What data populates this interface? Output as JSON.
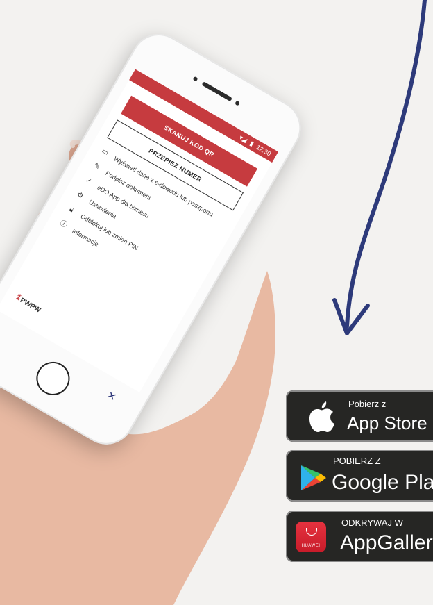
{
  "phone": {
    "status_time": "12:30",
    "scan_button": "SKANUJ KOD QR",
    "type_button": "PRZEPISZ NUMER",
    "menu": [
      {
        "icon": "id-card-icon",
        "label": "Wyświetl dane z e-dowodu lub paszportu"
      },
      {
        "icon": "signature-icon",
        "label": "Podpisz dokument"
      },
      {
        "icon": "check-icon",
        "label": "eDO App dla biznesu"
      },
      {
        "icon": "gear-icon",
        "label": "Ustawienia"
      },
      {
        "icon": "lock-icon",
        "label": "Odblokuj lub zmień PIN"
      },
      {
        "icon": "info-icon",
        "label": "Informacje"
      }
    ],
    "logo": "PWPW",
    "close_symbol": "×"
  },
  "badges": {
    "appstore": {
      "small": "Pobierz z",
      "big": "App Store"
    },
    "googleplay": {
      "small": "POBIERZ Z",
      "big": "Google Play"
    },
    "appgallery": {
      "small": "ODKRYWAJ W",
      "big": "AppGallery",
      "brand": "HUAWEI"
    }
  },
  "colors": {
    "brand_red": "#c63b3f",
    "arrow_blue": "#2d3a7a",
    "badge_bg": "#262624"
  }
}
